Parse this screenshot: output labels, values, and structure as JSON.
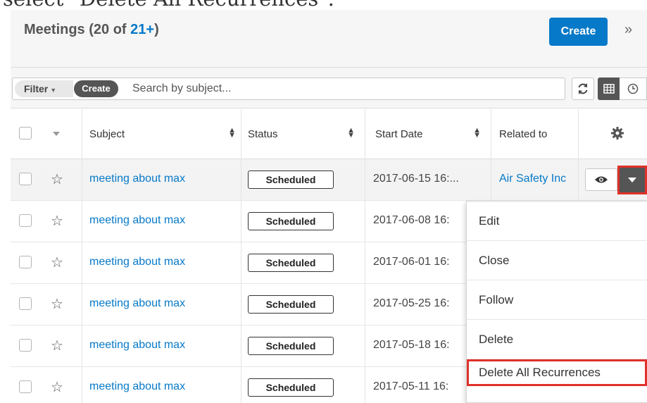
{
  "caption": "select \"Delete All Recurrences\".",
  "header": {
    "title": "Meetings (20 of ",
    "count": "21+",
    "title_close": ")",
    "create_label": "Create",
    "collapse_icon": "»"
  },
  "filterbar": {
    "filter_label": "Filter",
    "create_label": "Create",
    "search_placeholder": "Search by subject..."
  },
  "columns": {
    "subject": "Subject",
    "status": "Status",
    "start_date": "Start Date",
    "related_to": "Related to"
  },
  "rows": [
    {
      "subject": "meeting about max",
      "status": "Scheduled",
      "start_date": "2017-06-15 16:...",
      "related_to": "Air Safety Inc"
    },
    {
      "subject": "meeting about max",
      "status": "Scheduled",
      "start_date": "2017-06-08 16:",
      "related_to": ""
    },
    {
      "subject": "meeting about max",
      "status": "Scheduled",
      "start_date": "2017-06-01 16:",
      "related_to": ""
    },
    {
      "subject": "meeting about max",
      "status": "Scheduled",
      "start_date": "2017-05-25 16:",
      "related_to": ""
    },
    {
      "subject": "meeting about max",
      "status": "Scheduled",
      "start_date": "2017-05-18 16:",
      "related_to": ""
    },
    {
      "subject": "meeting about max",
      "status": "Scheduled",
      "start_date": "2017-05-11 16:",
      "related_to": ""
    }
  ],
  "menu": {
    "items": [
      "Edit",
      "Close",
      "Follow",
      "Delete",
      "Delete All Recurrences"
    ]
  },
  "colors": {
    "accent": "#0679c8",
    "highlight": "#e0312a"
  }
}
